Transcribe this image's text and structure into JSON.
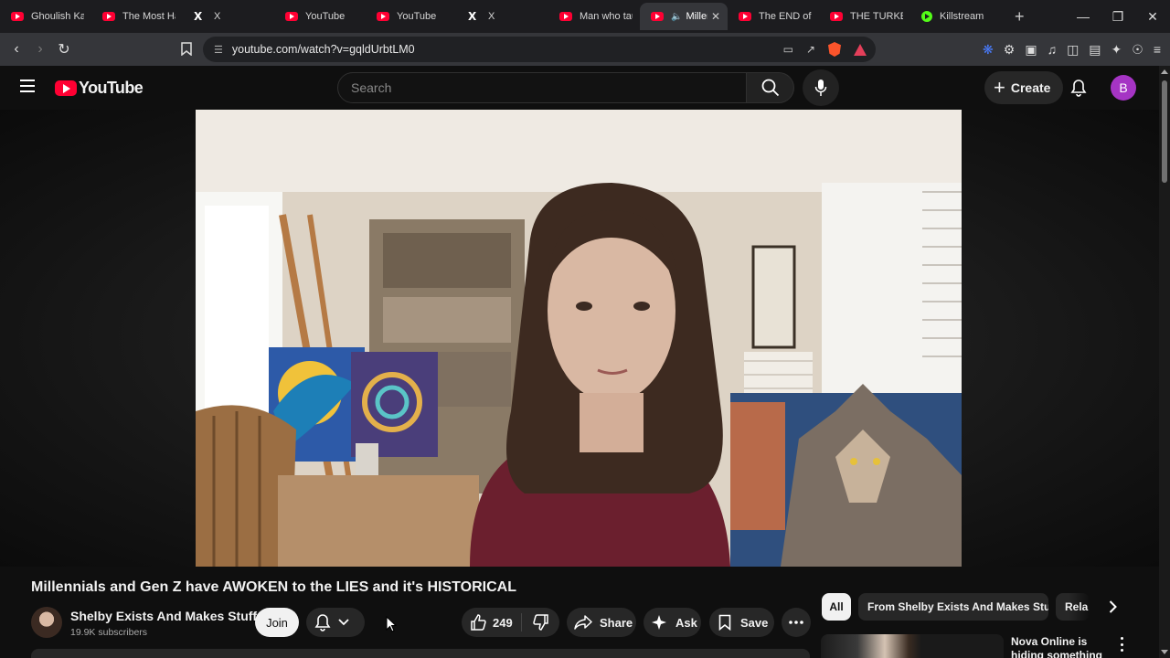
{
  "browser": {
    "tabs": [
      {
        "label": "Ghoulish Kara",
        "icon": "youtube-icon"
      },
      {
        "label": "The Most Hat",
        "icon": "youtube-icon"
      },
      {
        "label": "X",
        "icon": "x-icon"
      },
      {
        "label": "YouTube",
        "icon": "youtube-icon"
      },
      {
        "label": "YouTube",
        "icon": "youtube-icon"
      },
      {
        "label": "X",
        "icon": "x-icon"
      },
      {
        "label": "Man who tau",
        "icon": "youtube-icon"
      },
      {
        "label": "Miller",
        "icon": "youtube-icon",
        "active": true,
        "audio": true
      },
      {
        "label": "The END of L",
        "icon": "youtube-icon"
      },
      {
        "label": "THE TURKEY",
        "icon": "youtube-icon"
      },
      {
        "label": "Killstream",
        "icon": "kick-icon"
      }
    ],
    "url": "youtube.com/watch?v=gqldUrbtLM0"
  },
  "masthead": {
    "logo_text": "YouTube",
    "search_placeholder": "Search",
    "create_label": "Create",
    "avatar_letter": "B"
  },
  "video": {
    "title": "Millennials and Gen Z have AWOKEN to the LIES and it's HISTORICAL",
    "channel_name": "Shelby Exists And Makes Stuff",
    "subscribers": "19.9K subscribers",
    "join_label": "Join",
    "like_count": "249",
    "share_label": "Share",
    "ask_label": "Ask",
    "save_label": "Save"
  },
  "sidebar": {
    "chips": [
      "All",
      "From Shelby Exists And Makes Stuff",
      "Rela"
    ],
    "recommendation_title": "Nova Online is hiding something"
  },
  "colors": {
    "youtube_red": "#ff0033",
    "background": "#0f0f0f",
    "avatar": "#a534c4"
  }
}
